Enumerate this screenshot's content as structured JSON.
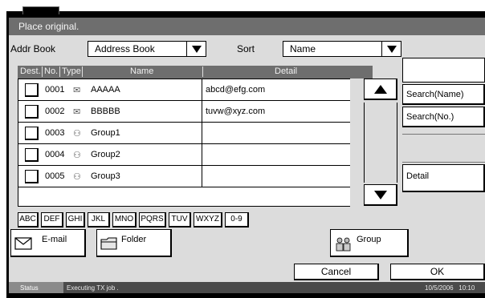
{
  "title": "Place original.",
  "addr_book": {
    "label": "Addr Book",
    "value": "Address Book"
  },
  "sort": {
    "label": "Sort",
    "value": "Name"
  },
  "columns": {
    "dest": "Dest.",
    "no": "No.",
    "type": "Type",
    "name": "Name",
    "detail": "Detail"
  },
  "rows": [
    {
      "no": "0001",
      "icon": "email-icon",
      "glyph": "✉",
      "name": "AAAAA",
      "detail": "abcd@efg.com"
    },
    {
      "no": "0002",
      "icon": "email-icon",
      "glyph": "✉",
      "name": "BBBBB",
      "detail": "tuvw@xyz.com"
    },
    {
      "no": "0003",
      "icon": "group-icon",
      "glyph": "⚇",
      "name": "Group1",
      "detail": ""
    },
    {
      "no": "0004",
      "icon": "group-icon",
      "glyph": "⚇",
      "name": "Group2",
      "detail": ""
    },
    {
      "no": "0005",
      "icon": "group-icon",
      "glyph": "⚇",
      "name": "Group3",
      "detail": ""
    }
  ],
  "side": {
    "search_name": "Search(Name)",
    "search_no": "Search(No.)",
    "detail": "Detail"
  },
  "alpha_keys": [
    "ABC",
    "DEF",
    "GHI",
    "JKL",
    "MNO",
    "PQRS",
    "TUV",
    "WXYZ",
    "0-9"
  ],
  "dest_buttons": {
    "email": "E-mail",
    "folder": "Folder",
    "group": "Group"
  },
  "bottom": {
    "cancel": "Cancel",
    "ok": "OK"
  },
  "status": {
    "label": "Status",
    "message": "Executing TX job .",
    "datetime": "10/5/2006   10:10"
  }
}
